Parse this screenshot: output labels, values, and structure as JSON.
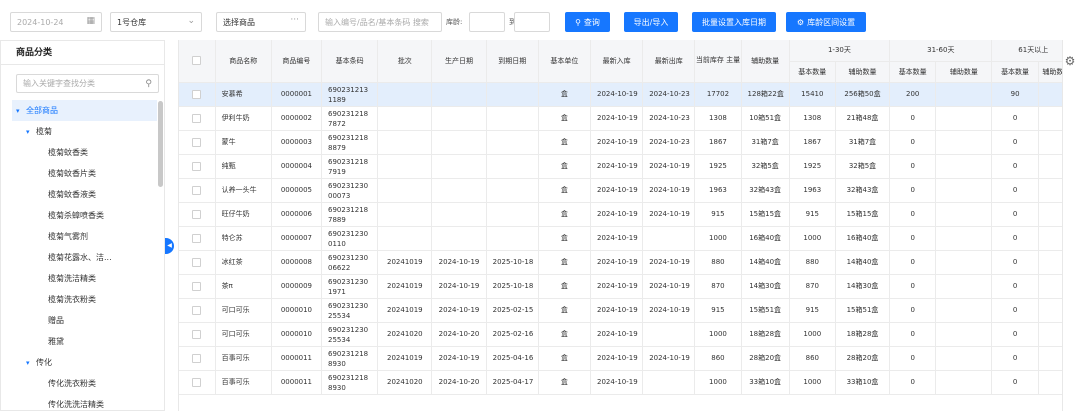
{
  "toolbar": {
    "date": "2024-10-24",
    "warehouse": "1号仓库",
    "product_select": "选择商品",
    "product_select_btn": "···",
    "search_placeholder": "输入编号/品名/基本条码 搜索",
    "stock_label": "库龄:",
    "to_label": "到",
    "query_btn": "查询",
    "export_btn": "导出/导入",
    "batch_btn": "批量设置入库日期",
    "range_btn": "库龄区间设置"
  },
  "sidebar": {
    "title": "商品分类",
    "search_placeholder": "输入关键字查找分类",
    "items": [
      {
        "label": "全部商品",
        "level": 0,
        "arrow": "▾",
        "selected": true
      },
      {
        "label": "榄菊",
        "level": 1,
        "arrow": "▾"
      },
      {
        "label": "榄菊蚊香类",
        "level": 2
      },
      {
        "label": "榄菊蚊香片类",
        "level": 2
      },
      {
        "label": "榄菊蚊香液类",
        "level": 2
      },
      {
        "label": "榄菊杀蟑喷香类",
        "level": 2
      },
      {
        "label": "榄菊气雾剂",
        "level": 2
      },
      {
        "label": "榄菊花露水、洁...",
        "level": 2
      },
      {
        "label": "榄菊洗洁精类",
        "level": 2
      },
      {
        "label": "榄菊洗衣粉类",
        "level": 2
      },
      {
        "label": "赠品",
        "level": 2
      },
      {
        "label": "雅黛",
        "level": 2
      },
      {
        "label": "传化",
        "level": 1,
        "arrow": "▾"
      },
      {
        "label": "传化洗衣粉类",
        "level": 2
      },
      {
        "label": "传化洗洗洁精类",
        "level": 2
      }
    ]
  },
  "table": {
    "headers": {
      "name": "商品名称",
      "code": "商品编号",
      "barcode": "基本条码",
      "batch": "批次",
      "prod_date": "生产日期",
      "exp_date": "到期日期",
      "unit": "基本单位",
      "in_date": "最新入库",
      "out_date": "最新出库",
      "stock": "当前库存\n主量",
      "aux": "辅助数量",
      "g1": "1-30天",
      "g2": "31-60天",
      "g3": "61天以上",
      "base_qty": "基本数量",
      "aux_qty": "辅助数量"
    },
    "rows": [
      {
        "name": "安慕希",
        "code": "0000001",
        "barcode": "6902312131189",
        "batch": "",
        "prod": "",
        "exp": "",
        "unit": "盒",
        "in": "2024-10-19",
        "out": "2024-10-23",
        "stock": "17702",
        "aux": "128箱22盒",
        "g1b": "15410",
        "g1a": "256箱50盒",
        "g2b": "200",
        "g2a": "",
        "g3b": "90",
        "g3a": ""
      },
      {
        "name": "伊利牛奶",
        "code": "0000002",
        "barcode": "6902312187872",
        "batch": "",
        "prod": "",
        "exp": "",
        "unit": "盒",
        "in": "2024-10-19",
        "out": "2024-10-23",
        "stock": "1308",
        "aux": "10箱51盒",
        "g1b": "1308",
        "g1a": "21箱48盒",
        "g2b": "0",
        "g2a": "",
        "g3b": "0",
        "g3a": ""
      },
      {
        "name": "蒙牛",
        "code": "0000003",
        "barcode": "6902312188879",
        "batch": "",
        "prod": "",
        "exp": "",
        "unit": "盒",
        "in": "2024-10-19",
        "out": "2024-10-23",
        "stock": "1867",
        "aux": "31箱7盒",
        "g1b": "1867",
        "g1a": "31箱7盒",
        "g2b": "0",
        "g2a": "",
        "g3b": "0",
        "g3a": ""
      },
      {
        "name": "纯甄",
        "code": "0000004",
        "barcode": "6902312187919",
        "batch": "",
        "prod": "",
        "exp": "",
        "unit": "盒",
        "in": "2024-10-19",
        "out": "2024-10-19",
        "stock": "1925",
        "aux": "32箱5盒",
        "g1b": "1925",
        "g1a": "32箱5盒",
        "g2b": "0",
        "g2a": "",
        "g3b": "0",
        "g3a": ""
      },
      {
        "name": "认养一头牛",
        "code": "0000005",
        "barcode": "69023123000073",
        "batch": "",
        "prod": "",
        "exp": "",
        "unit": "盒",
        "in": "2024-10-19",
        "out": "2024-10-19",
        "stock": "1963",
        "aux": "32箱43盒",
        "g1b": "1963",
        "g1a": "32箱43盒",
        "g2b": "0",
        "g2a": "",
        "g3b": "0",
        "g3a": ""
      },
      {
        "name": "旺仔牛奶",
        "code": "0000006",
        "barcode": "6902312187889",
        "batch": "",
        "prod": "",
        "exp": "",
        "unit": "盒",
        "in": "2024-10-19",
        "out": "2024-10-19",
        "stock": "915",
        "aux": "15箱15盒",
        "g1b": "915",
        "g1a": "15箱15盒",
        "g2b": "0",
        "g2a": "",
        "g3b": "0",
        "g3a": ""
      },
      {
        "name": "特仑苏",
        "code": "0000007",
        "barcode": "6902312300110",
        "batch": "",
        "prod": "",
        "exp": "",
        "unit": "盒",
        "in": "2024-10-19",
        "out": "",
        "stock": "1000",
        "aux": "16箱40盒",
        "g1b": "1000",
        "g1a": "16箱40盒",
        "g2b": "0",
        "g2a": "",
        "g3b": "0",
        "g3a": ""
      },
      {
        "name": "冰红茶",
        "code": "0000008",
        "barcode": "69023123006622",
        "batch": "20241019",
        "prod": "2024-10-19",
        "exp": "2025-10-18",
        "unit": "盒",
        "in": "2024-10-19",
        "out": "2024-10-19",
        "stock": "880",
        "aux": "14箱40盒",
        "g1b": "880",
        "g1a": "14箱40盒",
        "g2b": "0",
        "g2a": "",
        "g3b": "0",
        "g3a": ""
      },
      {
        "name": "茶π",
        "code": "0000009",
        "barcode": "6902312301971",
        "batch": "20241019",
        "prod": "2024-10-19",
        "exp": "2025-10-18",
        "unit": "盒",
        "in": "2024-10-19",
        "out": "2024-10-19",
        "stock": "870",
        "aux": "14箱30盒",
        "g1b": "870",
        "g1a": "14箱30盒",
        "g2b": "0",
        "g2a": "",
        "g3b": "0",
        "g3a": ""
      },
      {
        "name": "可口可乐",
        "code": "0000010",
        "barcode": "69023123025534",
        "batch": "20241019",
        "prod": "2024-10-19",
        "exp": "2025-02-15",
        "unit": "盒",
        "in": "2024-10-19",
        "out": "2024-10-19",
        "stock": "915",
        "aux": "15箱51盒",
        "g1b": "915",
        "g1a": "15箱51盒",
        "g2b": "0",
        "g2a": "",
        "g3b": "0",
        "g3a": ""
      },
      {
        "name": "可口可乐",
        "code": "0000010",
        "barcode": "69023123025534",
        "batch": "20241020",
        "prod": "2024-10-20",
        "exp": "2025-02-16",
        "unit": "盒",
        "in": "2024-10-19",
        "out": "",
        "stock": "1000",
        "aux": "18箱28盒",
        "g1b": "1000",
        "g1a": "18箱28盒",
        "g2b": "0",
        "g2a": "",
        "g3b": "0",
        "g3a": ""
      },
      {
        "name": "百事可乐",
        "code": "0000011",
        "barcode": "6902312188930",
        "batch": "20241019",
        "prod": "2024-10-19",
        "exp": "2025-04-16",
        "unit": "盒",
        "in": "2024-10-19",
        "out": "2024-10-19",
        "stock": "860",
        "aux": "28箱20盒",
        "g1b": "860",
        "g1a": "28箱20盒",
        "g2b": "0",
        "g2a": "",
        "g3b": "0",
        "g3a": ""
      },
      {
        "name": "百事可乐",
        "code": "0000011",
        "barcode": "6902312188930",
        "batch": "20241020",
        "prod": "2024-10-20",
        "exp": "2025-04-17",
        "unit": "盒",
        "in": "2024-10-19",
        "out": "",
        "stock": "1000",
        "aux": "33箱10盒",
        "g1b": "1000",
        "g1a": "33箱10盒",
        "g2b": "0",
        "g2a": "",
        "g3b": "0",
        "g3a": ""
      }
    ]
  }
}
